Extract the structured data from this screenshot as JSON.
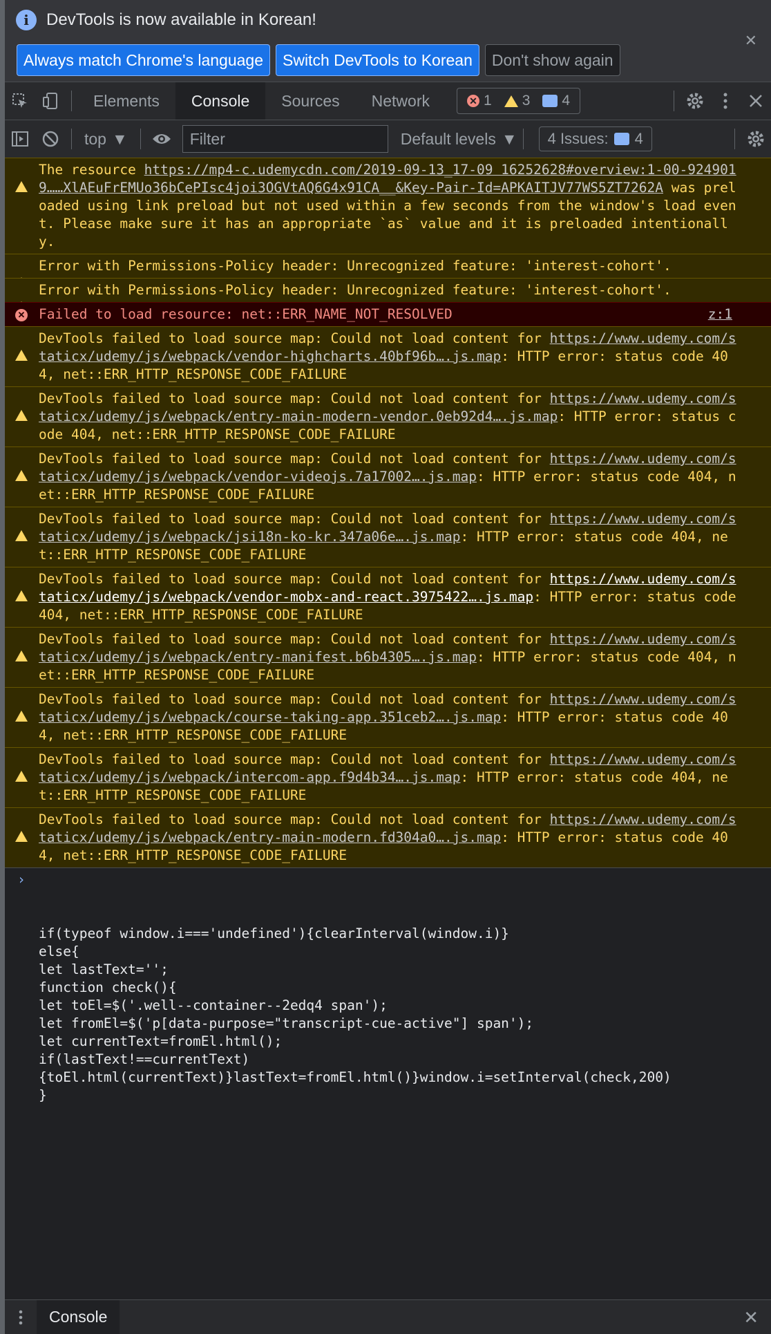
{
  "infobar": {
    "message": "DevTools is now available in Korean!",
    "buttons": [
      "Always match Chrome's language",
      "Switch DevTools to Korean",
      "Don't show again"
    ]
  },
  "tabs": [
    "Elements",
    "Console",
    "Sources",
    "Network"
  ],
  "active_tab": "Console",
  "counters": {
    "errors": "1",
    "warnings": "3",
    "messages": "4"
  },
  "toolbar": {
    "context": "top",
    "filter_placeholder": "Filter",
    "levels": "Default levels",
    "issues_label": "4 Issues:",
    "issues_count": "4"
  },
  "messages": [
    {
      "level": "warning",
      "parts": [
        {
          "t": "The resource "
        },
        {
          "t": "https://mp4-c.udemycdn.com/2019-09-13_17-09 16252628#overview:1-00-9249019……XlAEuFrEMUo36bCePIsc4joi3OGVtAQ6G4x91CA__&Key-Pair-Id=APKAITJV77WS5ZT7262A",
          "link": true
        },
        {
          "t": " was preloaded using link preload but not used within a few seconds from the window's load event. Please make sure it has an appropriate `as` value and it is preloaded intentionally."
        }
      ]
    },
    {
      "level": "warning",
      "parts": [
        {
          "t": "Error with Permissions-Policy header: Unrecognized feature: 'interest-cohort'."
        }
      ]
    },
    {
      "level": "warning",
      "parts": [
        {
          "t": "Error with Permissions-Policy header: Unrecognized feature: 'interest-cohort'."
        }
      ]
    },
    {
      "level": "error",
      "source": "z:1",
      "parts": [
        {
          "t": "Failed to load resource: net::ERR_NAME_NOT_RESOLVED"
        }
      ]
    },
    {
      "level": "warning",
      "parts": [
        {
          "t": "DevTools failed to load source map: Could not load content for "
        },
        {
          "t": "https://www.udemy.com/staticx/udemy/js/webpack/vendor-highcharts.40bf96b….js.map",
          "link": true
        },
        {
          "t": ": HTTP error: status code 404, net::ERR_HTTP_RESPONSE_CODE_FAILURE"
        }
      ]
    },
    {
      "level": "warning",
      "parts": [
        {
          "t": "DevTools failed to load source map: Could not load content for "
        },
        {
          "t": "https://www.udemy.com/staticx/udemy/js/webpack/entry-main-modern-vendor.0eb92d4….js.map",
          "link": true
        },
        {
          "t": ": HTTP error: status code 404, net::ERR_HTTP_RESPONSE_CODE_FAILURE"
        }
      ]
    },
    {
      "level": "warning",
      "parts": [
        {
          "t": "DevTools failed to load source map: Could not load content for "
        },
        {
          "t": "https://www.udemy.com/staticx/udemy/js/webpack/vendor-videojs.7a17002….js.map",
          "link": true
        },
        {
          "t": ": HTTP error: status code 404, net::ERR_HTTP_RESPONSE_CODE_FAILURE"
        }
      ]
    },
    {
      "level": "warning",
      "parts": [
        {
          "t": "DevTools failed to load source map: Could not load content for "
        },
        {
          "t": "https://www.udemy.com/staticx/udemy/js/webpack/jsi18n-ko-kr.347a06e….js.map",
          "link": true
        },
        {
          "t": ": HTTP error: status code 404, net::ERR_HTTP_RESPONSE_CODE_FAILURE"
        }
      ]
    },
    {
      "level": "warning",
      "parts": [
        {
          "t": "DevTools failed to load source map: Could not load content for "
        },
        {
          "t": "https://www.udemy.com/staticx/udemy/js/webpack/vendor-mobx-and-react.3975422….js.map",
          "link": true,
          "bright": true
        },
        {
          "t": ": HTTP error: status code 404, net::ERR_HTTP_RESPONSE_CODE_FAILURE"
        }
      ]
    },
    {
      "level": "warning",
      "parts": [
        {
          "t": "DevTools failed to load source map: Could not load content for "
        },
        {
          "t": "https://www.udemy.com/staticx/udemy/js/webpack/entry-manifest.b6b4305….js.map",
          "link": true
        },
        {
          "t": ": HTTP error: status code 404, net::ERR_HTTP_RESPONSE_CODE_FAILURE"
        }
      ]
    },
    {
      "level": "warning",
      "parts": [
        {
          "t": "DevTools failed to load source map: Could not load content for "
        },
        {
          "t": "https://www.udemy.com/staticx/udemy/js/webpack/course-taking-app.351ceb2….js.map",
          "link": true
        },
        {
          "t": ": HTTP error: status code 404, net::ERR_HTTP_RESPONSE_CODE_FAILURE"
        }
      ]
    },
    {
      "level": "warning",
      "parts": [
        {
          "t": "DevTools failed to load source map: Could not load content for "
        },
        {
          "t": "https://www.udemy.com/staticx/udemy/js/webpack/intercom-app.f9d4b34….js.map",
          "link": true
        },
        {
          "t": ": HTTP error: status code 404, net::ERR_HTTP_RESPONSE_CODE_FAILURE"
        }
      ]
    },
    {
      "level": "warning",
      "parts": [
        {
          "t": "DevTools failed to load source map: Could not load content for "
        },
        {
          "t": "https://www.udemy.com/staticx/udemy/js/webpack/entry-main-modern.fd304a0….js.map",
          "link": true
        },
        {
          "t": ": HTTP error: status code 404, net::ERR_HTTP_RESPONSE_CODE_FAILURE"
        }
      ]
    }
  ],
  "prompt_lines": [
    "if(typeof window.i==='undefined'){clearInterval(window.i)}",
    "else{",
    "let lastText='';",
    "function check(){",
    "let toEl=$('.well--container--2edq4 span');",
    "let fromEl=$('p[data-purpose=\"transcript-cue-active\"] span');",
    "let currentText=fromEl.html();",
    "if(lastText!==currentText)",
    "{toEl.html(currentText)}lastText=fromEl.html()}window.i=setInterval(check,200)",
    "}"
  ],
  "drawer": {
    "tab": "Console"
  },
  "colors": {
    "accent": "#1a73e8",
    "warning_text": "#fdd663",
    "error_text": "#f28b82",
    "link_blue": "#8ab4f8"
  }
}
